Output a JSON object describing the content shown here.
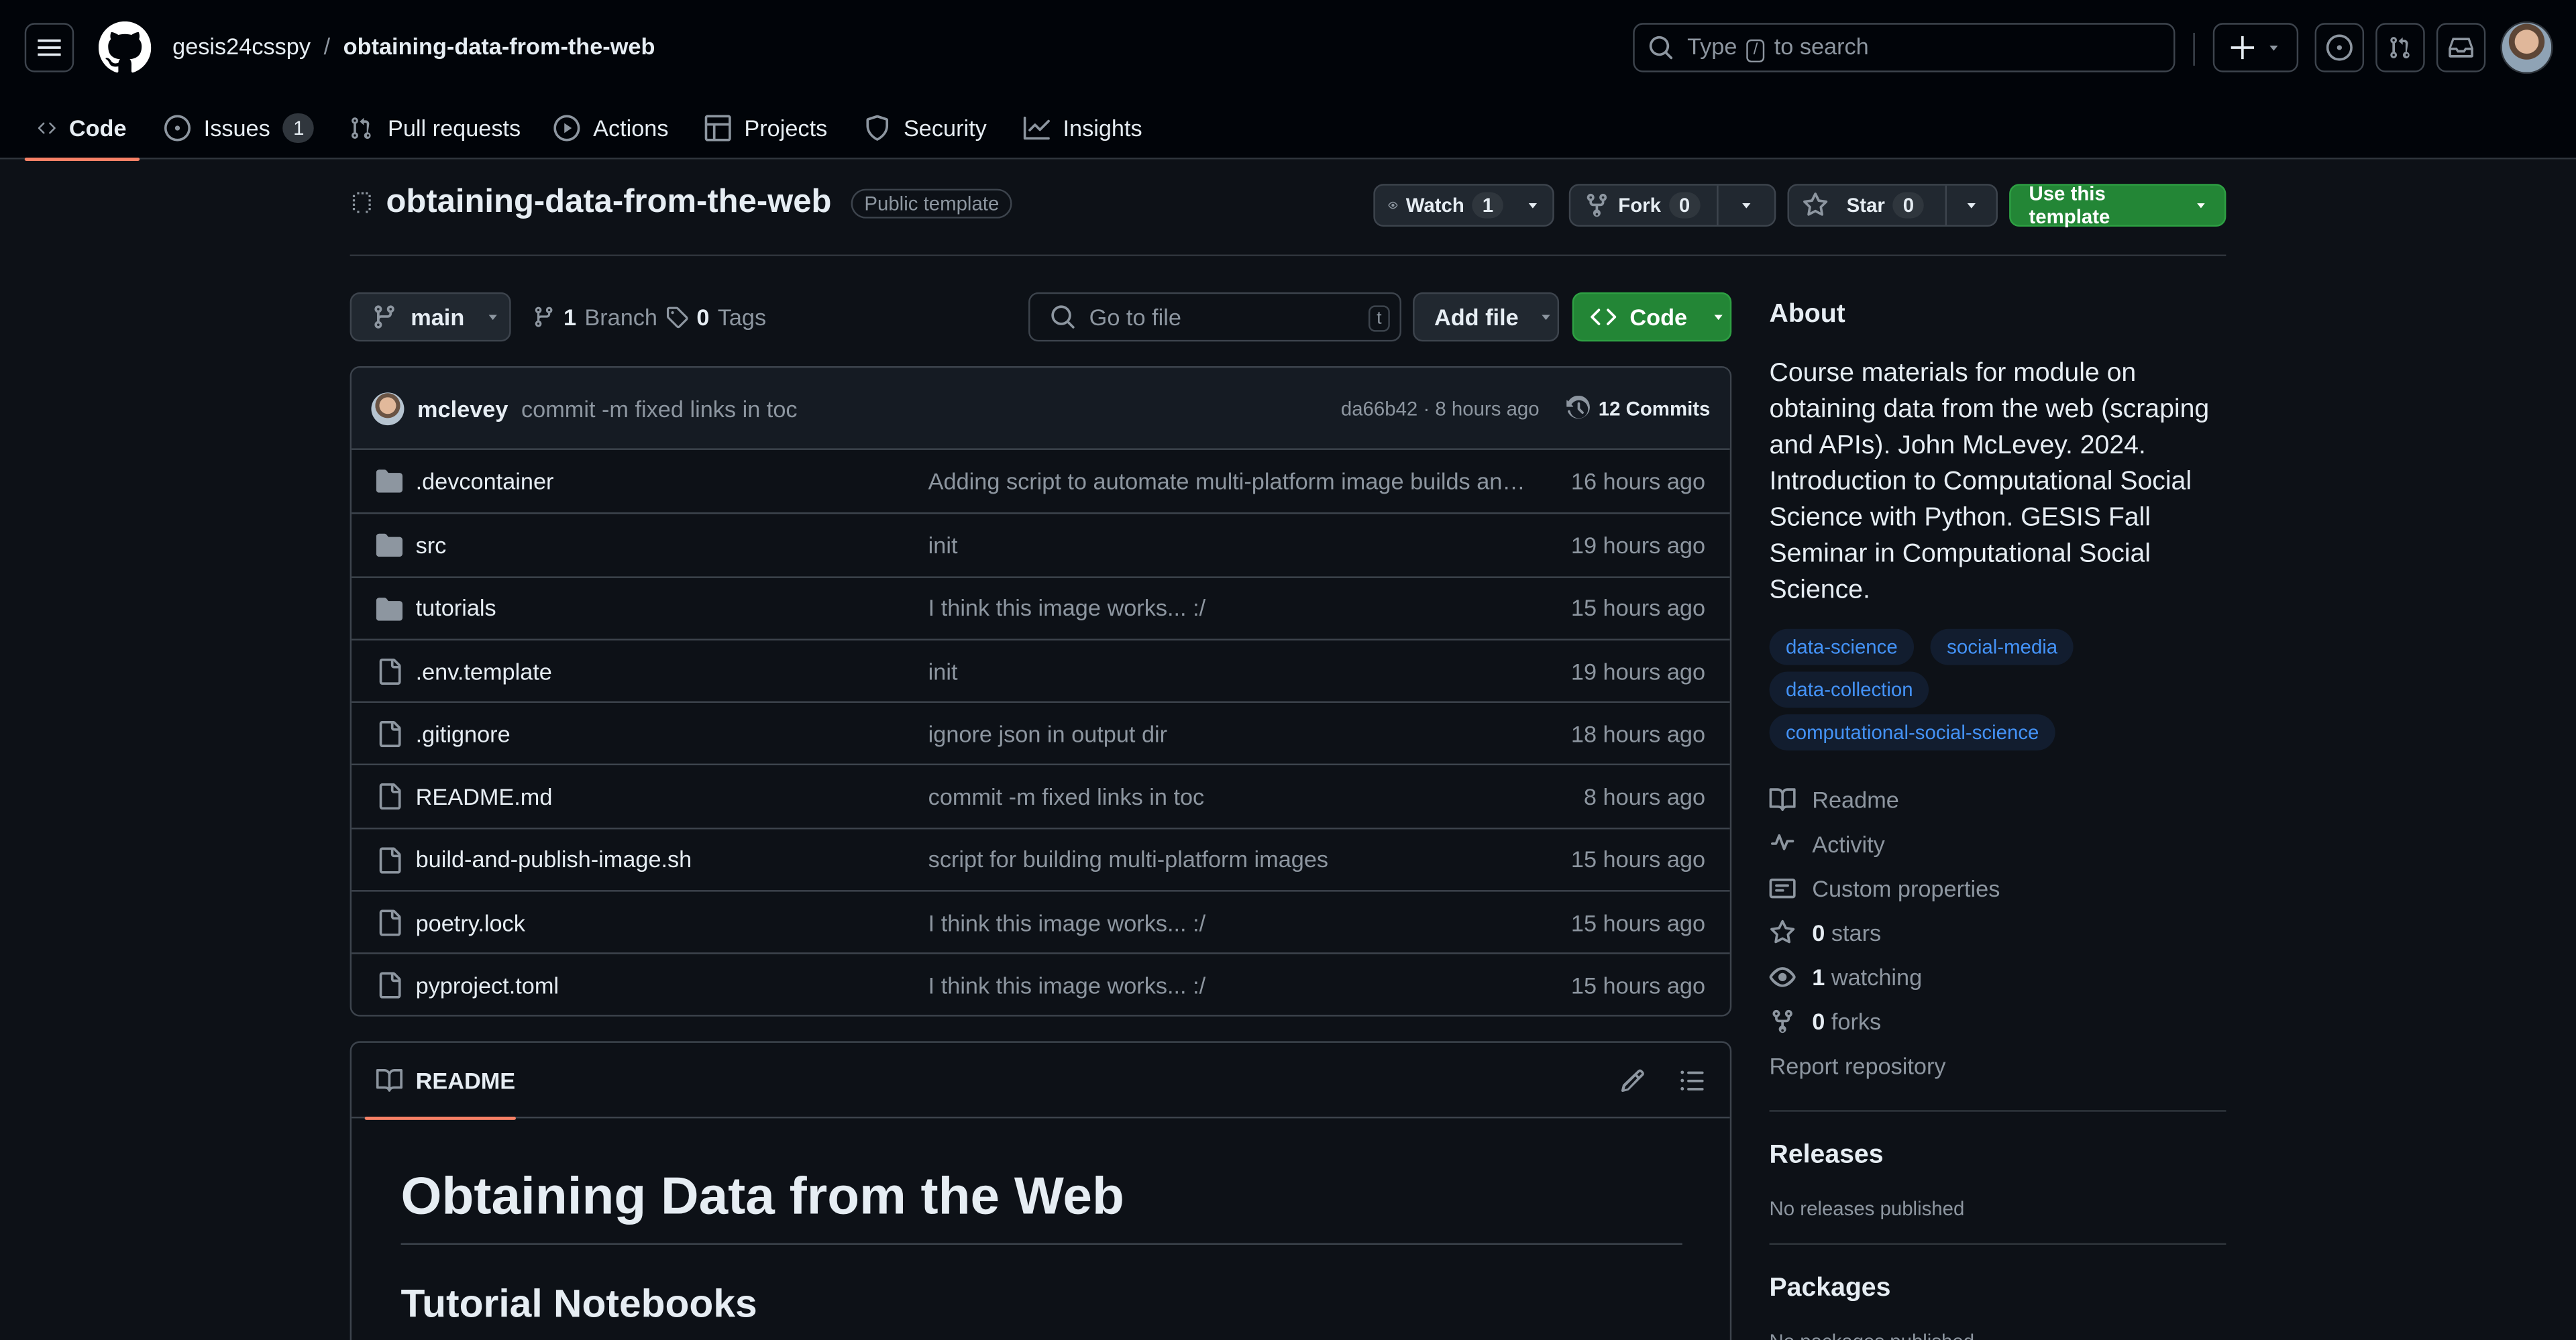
{
  "header": {
    "owner": "gesis24csspy",
    "separator": "/",
    "repo": "obtaining-data-from-the-web",
    "search_prefix": "Type",
    "search_key": "/",
    "search_suffix": "to search"
  },
  "tabs": [
    {
      "label": "Code",
      "icon": "code-icon"
    },
    {
      "label": "Issues",
      "icon": "issue-icon",
      "count": "1"
    },
    {
      "label": "Pull requests",
      "icon": "pull-request-icon"
    },
    {
      "label": "Actions",
      "icon": "play-icon"
    },
    {
      "label": "Projects",
      "icon": "table-icon"
    },
    {
      "label": "Security",
      "icon": "shield-icon"
    },
    {
      "label": "Insights",
      "icon": "graph-icon"
    }
  ],
  "repo_head": {
    "name": "obtaining-data-from-the-web",
    "visibility": "Public template",
    "watch_label": "Watch",
    "watch_count": "1",
    "fork_label": "Fork",
    "fork_count": "0",
    "star_label": "Star",
    "star_count": "0",
    "use_template_label": "Use this template"
  },
  "toolbar": {
    "branch": "main",
    "branches_count": "1",
    "branches_label": "Branch",
    "tags_count": "0",
    "tags_label": "Tags",
    "go_to_file_placeholder": "Go to file",
    "go_to_file_key": "t",
    "add_file_label": "Add file",
    "code_label": "Code"
  },
  "latest_commit": {
    "author": "mclevey",
    "message": "commit -m fixed links in toc",
    "sha_time": "da66b42 · 8 hours ago",
    "commits_label": "12 Commits"
  },
  "files": [
    {
      "type": "folder",
      "name": ".devcontainer",
      "message": "Adding script to automate multi-platform image builds and pushes",
      "age": "16 hours ago"
    },
    {
      "type": "folder",
      "name": "src",
      "message": "init",
      "age": "19 hours ago"
    },
    {
      "type": "folder",
      "name": "tutorials",
      "message": "I think this image works... :/",
      "age": "15 hours ago"
    },
    {
      "type": "file",
      "name": ".env.template",
      "message": "init",
      "age": "19 hours ago"
    },
    {
      "type": "file",
      "name": ".gitignore",
      "message": "ignore json in output dir",
      "age": "18 hours ago"
    },
    {
      "type": "file",
      "name": "README.md",
      "message": "commit -m fixed links in toc",
      "age": "8 hours ago"
    },
    {
      "type": "file",
      "name": "build-and-publish-image.sh",
      "message": "script for building multi-platform images",
      "age": "15 hours ago"
    },
    {
      "type": "file",
      "name": "poetry.lock",
      "message": "I think this image works... :/",
      "age": "15 hours ago"
    },
    {
      "type": "file",
      "name": "pyproject.toml",
      "message": "I think this image works... :/",
      "age": "15 hours ago"
    }
  ],
  "readme": {
    "tab_label": "README",
    "h1": "Obtaining Data from the Web",
    "h2": "Tutorial Notebooks"
  },
  "about": {
    "heading": "About",
    "description": "Course materials for module on obtaining data from the web (scraping and APIs). John McLevey. 2024. Introduction to Computational Social Science with Python. GESIS Fall Seminar in Computational Social Science.",
    "topics": [
      "data-science",
      "social-media",
      "data-collection",
      "computational-social-science"
    ],
    "readme_link": "Readme",
    "activity_link": "Activity",
    "custom_properties_link": "Custom properties",
    "stars_count": "0",
    "stars_label": "stars",
    "watching_count": "1",
    "watching_label": "watching",
    "forks_count": "0",
    "forks_label": "forks",
    "report_link": "Report repository"
  },
  "releases": {
    "heading": "Releases",
    "empty": "No releases published"
  },
  "packages": {
    "heading": "Packages",
    "empty": "No packages published"
  },
  "colors": {
    "accent_green": "#238636",
    "link_blue": "#4493f8",
    "tab_underline": "#f78166",
    "bg": "#0d1117"
  }
}
